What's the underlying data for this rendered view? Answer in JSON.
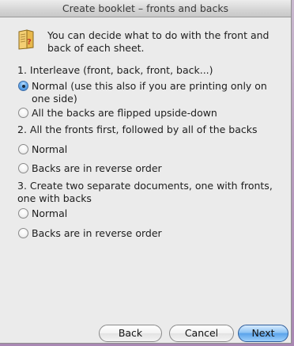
{
  "window": {
    "title": "Create booklet – fronts and backs"
  },
  "intro": {
    "icon": "booklet-document-icon",
    "text": "You can decide what to do with the front and back of each sheet."
  },
  "sections": [
    {
      "heading": "1. Interleave (front, back, front, back...)",
      "options": [
        {
          "label": "Normal (use this also if you are printing only on one side)",
          "checked": true
        },
        {
          "label": "All the backs are flipped upside-down",
          "checked": false
        }
      ]
    },
    {
      "heading": "2. All the fronts first, followed by all of the backs",
      "options": [
        {
          "label": "Normal",
          "checked": false
        },
        {
          "label": "Backs are in reverse order",
          "checked": false
        }
      ]
    },
    {
      "heading": "3. Create two separate documents, one with fronts, one with backs",
      "options": [
        {
          "label": "Normal",
          "checked": false
        },
        {
          "label": "Backs are in reverse order",
          "checked": false
        }
      ]
    }
  ],
  "buttons": {
    "back": "Back",
    "cancel": "Cancel",
    "next": "Next"
  },
  "colors": {
    "accent": "#5aa3ea",
    "window_background": "#ebebeb"
  }
}
